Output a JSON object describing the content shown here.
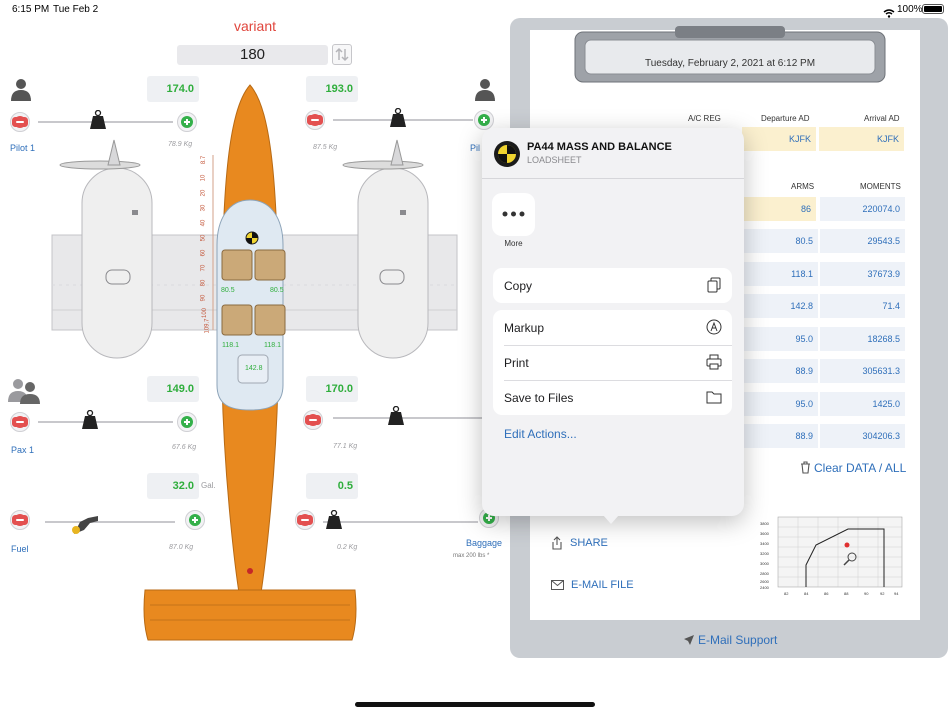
{
  "status_bar": {
    "time": "6:15 PM",
    "date": "Tue Feb 2",
    "battery": "100%"
  },
  "variant": {
    "title": "variant",
    "value": "180"
  },
  "stations": {
    "pilot1": {
      "value": "174.0",
      "label": "Pilot 1",
      "unit": "78.9 Kg"
    },
    "pilot2": {
      "value": "193.0",
      "label": "Pil",
      "unit": "87.5 Kg"
    },
    "pax1": {
      "value": "149.0",
      "label": "Pax 1",
      "unit": "67.6 Kg"
    },
    "pax2": {
      "value": "170.0",
      "label": "",
      "unit": "77.1 Kg"
    },
    "fuel": {
      "value": "32.0",
      "suffix": "Gal.",
      "label": "Fuel",
      "unit": "87.0 Kg"
    },
    "baggage": {
      "value": "0.5",
      "label": "Baggage",
      "unit": "0.2 Kg",
      "note": "max 200 lbs *"
    }
  },
  "scale_ticks": [
    "8.7",
    "10",
    "20",
    "30",
    "40",
    "50",
    "60",
    "70",
    "80",
    "90",
    "100",
    "109.7"
  ],
  "cabin_labels": {
    "row1_left": "80.5",
    "row1_right": "80.5",
    "row2_left": "118.1",
    "row2_right": "118.1",
    "baggage": "142.8"
  },
  "clipboard": {
    "date": "Tuesday, February 2, 2021 at 6:12 PM",
    "headers": {
      "ac_reg": "A/C REG",
      "departure": "Departure AD",
      "arrival": "Arrival AD",
      "arms": "ARMS",
      "moments": "MOMENTS"
    },
    "departure_value": "KJFK",
    "arrival_value": "KJFK",
    "arms": [
      "86",
      "80.5",
      "118.1",
      "142.8",
      "95.0",
      "88.9",
      "95.0",
      "88.9"
    ],
    "moments": [
      "220074.0",
      "29543.5",
      "37673.9",
      "71.4",
      "18268.5",
      "305631.3",
      "1425.0",
      "304206.3"
    ],
    "clear_label": "Clear DATA / ALL",
    "share_label": "SHARE",
    "email_file_label": "E-MAIL FILE",
    "support_label": "E-Mail Support"
  },
  "envelope_chart": {
    "y_ticks": [
      "3800",
      "3600",
      "3400",
      "3200",
      "3000",
      "2800",
      "2600",
      "2400"
    ],
    "x_ticks": [
      "82",
      "84",
      "86",
      "88",
      "90",
      "92",
      "94"
    ]
  },
  "share_sheet": {
    "title": "PA44 MASS AND BALANCE",
    "subtitle": "LOADSHEET",
    "more_label": "More",
    "group1": [
      {
        "label": "Copy",
        "icon": "copy-icon"
      }
    ],
    "group2": [
      {
        "label": "Markup",
        "icon": "markup-icon"
      },
      {
        "label": "Print",
        "icon": "print-icon"
      },
      {
        "label": "Save to Files",
        "icon": "folder-icon"
      }
    ],
    "edit_actions": "Edit Actions..."
  },
  "colors": {
    "accent_blue": "#2f6fba",
    "airframe_orange": "#e8891f",
    "green_value": "#2fae3c",
    "variant_red": "#e0463d"
  }
}
